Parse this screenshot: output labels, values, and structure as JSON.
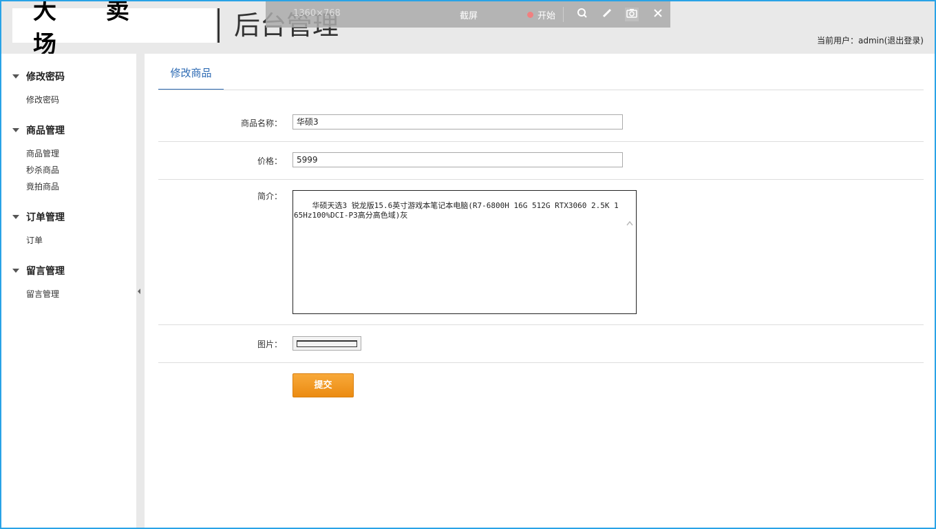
{
  "header": {
    "logo": "大 卖 场",
    "title": "后台管理",
    "user_prefix": "当前用户：",
    "username": "admin",
    "logout": "(退出登录)"
  },
  "capture_toolbar": {
    "size_text": "1360×768",
    "title": "截屏",
    "start_label": "开始",
    "icons": [
      "search-icon",
      "pen-icon",
      "camera-icon",
      "close-icon"
    ]
  },
  "sidebar": {
    "sections": [
      {
        "title": "修改密码",
        "items": [
          "修改密码"
        ]
      },
      {
        "title": "商品管理",
        "items": [
          "商品管理",
          "秒杀商品",
          "竟拍商品"
        ]
      },
      {
        "title": "订单管理",
        "items": [
          "订单"
        ]
      },
      {
        "title": "留言管理",
        "items": [
          "留言管理"
        ]
      }
    ]
  },
  "main": {
    "tab": "修改商品",
    "form": {
      "name_label": "商品名称：",
      "name_value": "华硕3",
      "price_label": "价格：",
      "price_value": "5999",
      "desc_label": "简介：",
      "desc_value": "华硕天选3 锐龙版15.6英寸游戏本笔记本电脑(R7-6800H 16G 512G RTX3060 2.5K 165Hz100%DCI-P3高分高色域)灰",
      "image_label": "图片：",
      "submit_label": "提交"
    }
  },
  "colors": {
    "accent_blue": "#2c6ab3",
    "submit_orange": "#f19a20",
    "frame_border": "#29a3e6"
  }
}
